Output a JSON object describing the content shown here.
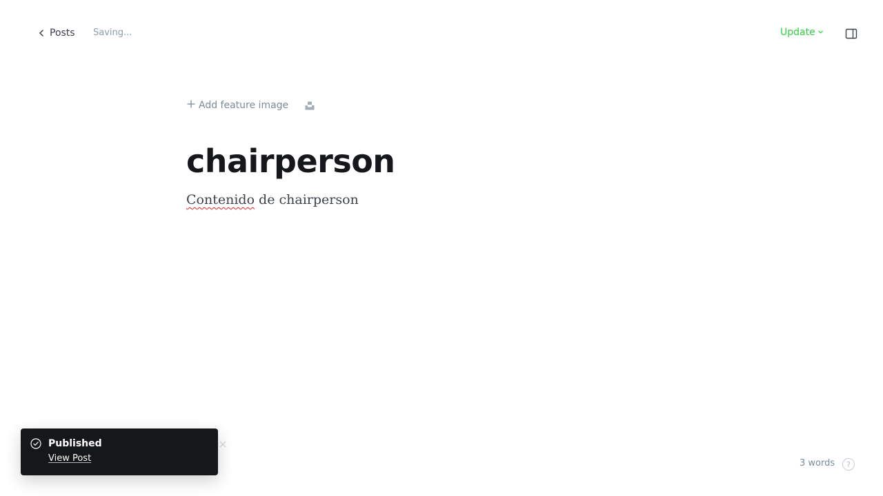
{
  "header": {
    "back_label": "Posts",
    "status_text": "Saving...",
    "update_label": "Update"
  },
  "editor": {
    "feature_image_label": "Add feature image",
    "title": "chairperson",
    "body_misspelled": "Contenido",
    "body_rest": " de chairperson"
  },
  "toast": {
    "title": "Published",
    "link_label": "View Post"
  },
  "footer": {
    "word_count": "3 words",
    "help_glyph": "?"
  },
  "colors": {
    "accent_green": "#30cf43",
    "toast_bg": "#15171a",
    "muted_text": "#7c8b9a"
  },
  "icons": {
    "back": "chevron-left-icon",
    "update_caret": "chevron-down-icon",
    "settings_toggle": "sidebar-panel-icon",
    "feature_add": "plus-icon",
    "unsplash": "unsplash-icon",
    "toast_status": "check-circle-icon",
    "toast_close": "close-icon",
    "help": "help-icon"
  }
}
